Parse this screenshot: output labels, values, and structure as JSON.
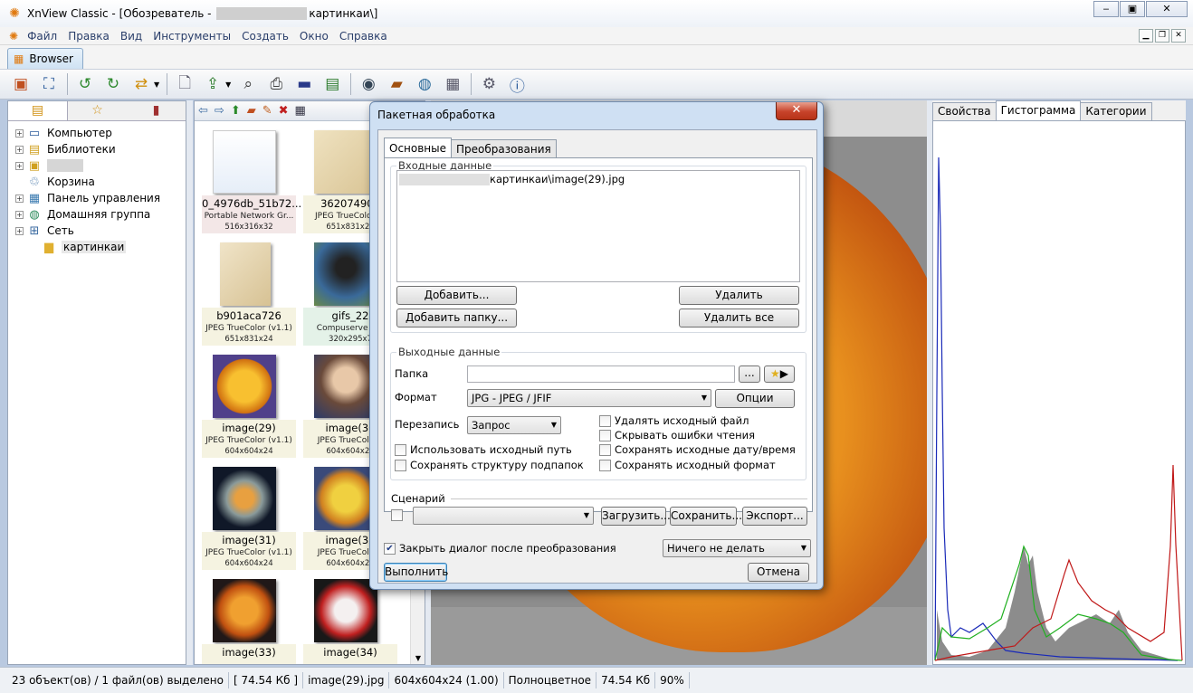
{
  "window": {
    "title_prefix": "XnView Classic - [Обозреватель - ",
    "title_suffix": "картинкаи\\]"
  },
  "menu": [
    "Файл",
    "Правка",
    "Вид",
    "Инструменты",
    "Создать",
    "Окно",
    "Справка"
  ],
  "tab": {
    "label": "Browser"
  },
  "tree": [
    {
      "label": "Компьютер",
      "icon": "computer-icon"
    },
    {
      "label": "Библиотеки",
      "icon": "libraries-icon"
    },
    {
      "label": "",
      "icon": "user-folder-icon"
    },
    {
      "label": "Корзина",
      "icon": "recycle-bin-icon"
    },
    {
      "label": "Панель управления",
      "icon": "control-panel-icon"
    },
    {
      "label": "Домашняя группа",
      "icon": "homegroup-icon"
    },
    {
      "label": "Сеть",
      "icon": "network-icon"
    },
    {
      "label": "картинкаи",
      "icon": "folder-icon"
    }
  ],
  "thumbnails": [
    {
      "name": "0_4976db_51b72...",
      "type": "Portable Network Gr...",
      "size": "516x316x32"
    },
    {
      "name": "36207490b",
      "type": "JPEG TrueColor (v",
      "size": "651x831x24"
    },
    {
      "name": "b901aca726",
      "type": "JPEG TrueColor (v1.1)",
      "size": "651x831x24"
    },
    {
      "name": "gifs_22",
      "type": "Compuserve GIF",
      "size": "320x295x7"
    },
    {
      "name": "image(29)",
      "type": "JPEG TrueColor (v1.1)",
      "size": "604x604x24"
    },
    {
      "name": "image(30",
      "type": "JPEG TrueColor (",
      "size": "604x604x24"
    },
    {
      "name": "image(31)",
      "type": "JPEG TrueColor (v1.1)",
      "size": "604x604x24"
    },
    {
      "name": "image(32",
      "type": "JPEG TrueColor (",
      "size": "604x604x24"
    },
    {
      "name": "image(33)",
      "type": "",
      "size": ""
    },
    {
      "name": "image(34)",
      "type": "",
      "size": ""
    }
  ],
  "right_tabs": [
    "Свойства",
    "Гистограмма",
    "Категории"
  ],
  "status": {
    "selection": "23 объект(ов) / 1 файл(ов) выделено",
    "size": "[ 74.54 Кб ]",
    "file": "image(29).jpg",
    "dims": "604x604x24 (1.00)",
    "color": "Полноцветное",
    "filesize": "74.54 Кб",
    "zoom": "90%"
  },
  "dialog": {
    "title": "Пакетная обработка",
    "tabs": [
      "Основные",
      "Преобразования"
    ],
    "input_group": "Входные данные",
    "input_file": "картинкаи\\image(29).jpg",
    "add": "Добавить...",
    "add_folder": "Добавить папку...",
    "remove": "Удалить",
    "remove_all": "Удалить все",
    "output_group": "Выходные данные",
    "folder_label": "Папка",
    "browse": "...",
    "format_label": "Формат",
    "format_value": "JPG - JPEG / JFIF",
    "options": "Опции",
    "overwrite_label": "Перезапись",
    "overwrite_value": "Запрос",
    "cb_use_source_path": "Использовать исходный путь",
    "cb_keep_subfolders": "Сохранять структуру подпапок",
    "cb_delete_source": "Удалять исходный файл",
    "cb_hide_errors": "Скрывать ошибки чтения",
    "cb_keep_date": "Сохранять исходные дату/время",
    "cb_keep_format": "Сохранять исходный формат",
    "scenario_label": "Сценарий",
    "load": "Загрузить...",
    "save": "Сохранить...",
    "export": "Экспорт...",
    "close_after": "Закрыть диалог после преобразования",
    "after_action": "Ничего не делать",
    "run": "Выполнить",
    "cancel": "Отмена"
  }
}
